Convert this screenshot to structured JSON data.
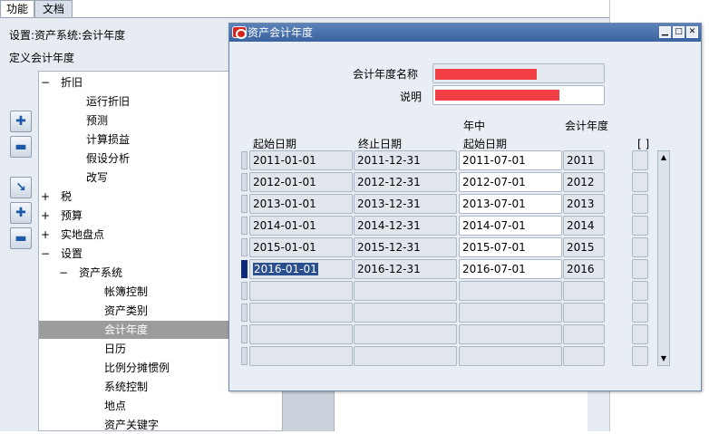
{
  "nav": {
    "tabs": [
      "功能",
      "文档"
    ],
    "title": "设置:资产系统:会计年度",
    "subtitle": "定义会计年度",
    "tree": [
      {
        "toggle": "−",
        "label": "折旧",
        "level": 0
      },
      {
        "toggle": "",
        "label": "运行折旧",
        "level": 2
      },
      {
        "toggle": "",
        "label": "预测",
        "level": 2
      },
      {
        "toggle": "",
        "label": "计算损益",
        "level": 2
      },
      {
        "toggle": "",
        "label": "假设分析",
        "level": 2
      },
      {
        "toggle": "",
        "label": "改写",
        "level": 2
      },
      {
        "toggle": "+",
        "label": "税",
        "level": 0
      },
      {
        "toggle": "+",
        "label": "预算",
        "level": 0
      },
      {
        "toggle": "+",
        "label": "实地盘点",
        "level": 0
      },
      {
        "toggle": "−",
        "label": "设置",
        "level": 0
      },
      {
        "toggle": "−",
        "label": "资产系统",
        "level": 1
      },
      {
        "toggle": "",
        "label": "帐簿控制",
        "level": 3
      },
      {
        "toggle": "",
        "label": "资产类别",
        "level": 3
      },
      {
        "toggle": "",
        "label": "会计年度",
        "level": 3,
        "selected": true
      },
      {
        "toggle": "",
        "label": "日历",
        "level": 3
      },
      {
        "toggle": "",
        "label": "比例分摊惯例",
        "level": 3
      },
      {
        "toggle": "",
        "label": "系统控制",
        "level": 3
      },
      {
        "toggle": "",
        "label": "地点",
        "level": 3
      },
      {
        "toggle": "",
        "label": "资产关键字",
        "level": 3
      }
    ],
    "side_buttons": [
      "plus-icon",
      "minus-icon",
      "expand-branch-icon",
      "expand-all-icon",
      "collapse-all-icon"
    ]
  },
  "window": {
    "title": "资产会计年度",
    "buttons": [
      "minimize",
      "maximize",
      "close"
    ],
    "name_label": "会计年度名称",
    "name_value": "",
    "desc_label": "说明",
    "desc_value": "",
    "col_headers": {
      "start": "起始日期",
      "end": "终止日期",
      "mid_top": "年中",
      "mid": "起始日期",
      "year": "会计年度",
      "flag": "[ ]"
    },
    "rows": [
      {
        "start": "2011-01-01",
        "end": "2011-12-31",
        "mid": "2011-07-01",
        "year": "2011"
      },
      {
        "start": "2012-01-01",
        "end": "2012-12-31",
        "mid": "2012-07-01",
        "year": "2012"
      },
      {
        "start": "2013-01-01",
        "end": "2013-12-31",
        "mid": "2013-07-01",
        "year": "2013"
      },
      {
        "start": "2014-01-01",
        "end": "2014-12-31",
        "mid": "2014-07-01",
        "year": "2014"
      },
      {
        "start": "2015-01-01",
        "end": "2015-12-31",
        "mid": "2015-07-01",
        "year": "2015"
      },
      {
        "start": "2016-01-01",
        "end": "2016-12-31",
        "mid": "2016-07-01",
        "year": "2016"
      },
      {
        "start": "",
        "end": "",
        "mid": "",
        "year": ""
      },
      {
        "start": "",
        "end": "",
        "mid": "",
        "year": ""
      },
      {
        "start": "",
        "end": "",
        "mid": "",
        "year": ""
      },
      {
        "start": "",
        "end": "",
        "mid": "",
        "year": ""
      }
    ],
    "current_row": 5
  },
  "colors": {
    "titlebar": "#3a63a0",
    "panel": "#e8eef4",
    "selected_tree": "#9c9c9c",
    "redaction": "#f24046"
  }
}
